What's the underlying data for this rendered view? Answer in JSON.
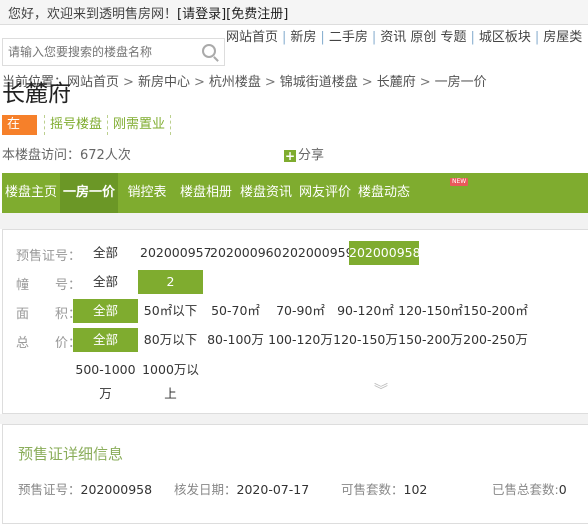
{
  "topbar": {
    "welcome": "您好，欢迎来到透明售房网！",
    "login": "[请登录]",
    "register": "[免费注册]"
  },
  "topnav": [
    "网站首页",
    "新房",
    "二手房",
    "资讯 原创 专题",
    "城区板块",
    "房屋类"
  ],
  "search": {
    "placeholder": "请输入您要搜索的楼盘名称",
    "icon": "search-icon"
  },
  "breadcrumb": {
    "prefix": "当前位置：",
    "items": [
      "网站首页",
      "新房中心",
      "杭州楼盘",
      "锦城街道楼盘",
      "长麓府",
      "一房一价"
    ]
  },
  "title": "长麓府",
  "tags": [
    "在售",
    "摇号楼盘",
    "刚需置业"
  ],
  "visits": "本楼盘访问：672人次",
  "share": "分享",
  "nav": {
    "items": [
      "楼盘主页",
      "一房一价",
      "销控表",
      "楼盘相册",
      "楼盘资讯",
      "网友评价",
      "楼盘动态"
    ],
    "active": "一房一价",
    "new_badge": "NEW"
  },
  "filters": [
    {
      "label": "预售证号：",
      "options": [
        "全部",
        "202000957",
        "202000960",
        "202000959",
        "202000958"
      ],
      "selected": "202000958"
    },
    {
      "label": "幢　　号：",
      "options": [
        "全部",
        "2"
      ],
      "selected": "2"
    },
    {
      "label": "面　　积：",
      "options": [
        "全部",
        "50㎡以下",
        "50-70㎡",
        "70-90㎡",
        "90-120㎡",
        "120-150㎡",
        "150-200㎡"
      ],
      "selected": "全部"
    },
    {
      "label": "总　　价：",
      "options": [
        "全部",
        "80万以下",
        "80-100万",
        "100-120万",
        "120-150万",
        "150-200万",
        "200-250万",
        "500-1000万",
        "1000万以上"
      ],
      "selected": "全部"
    }
  ],
  "detail": {
    "title": "预售证详细信息",
    "cert_label": "预售证号：",
    "cert": "202000958",
    "date_label": "核发日期：",
    "date": "2020-07-17",
    "avail_label": "可售套数：",
    "avail": "102",
    "sold_label": "已售总套数:",
    "sold": "0"
  },
  "colors": {
    "accent": "#7fac2f",
    "active_tab": "#6b9726",
    "on_sale": "#f6802a"
  }
}
